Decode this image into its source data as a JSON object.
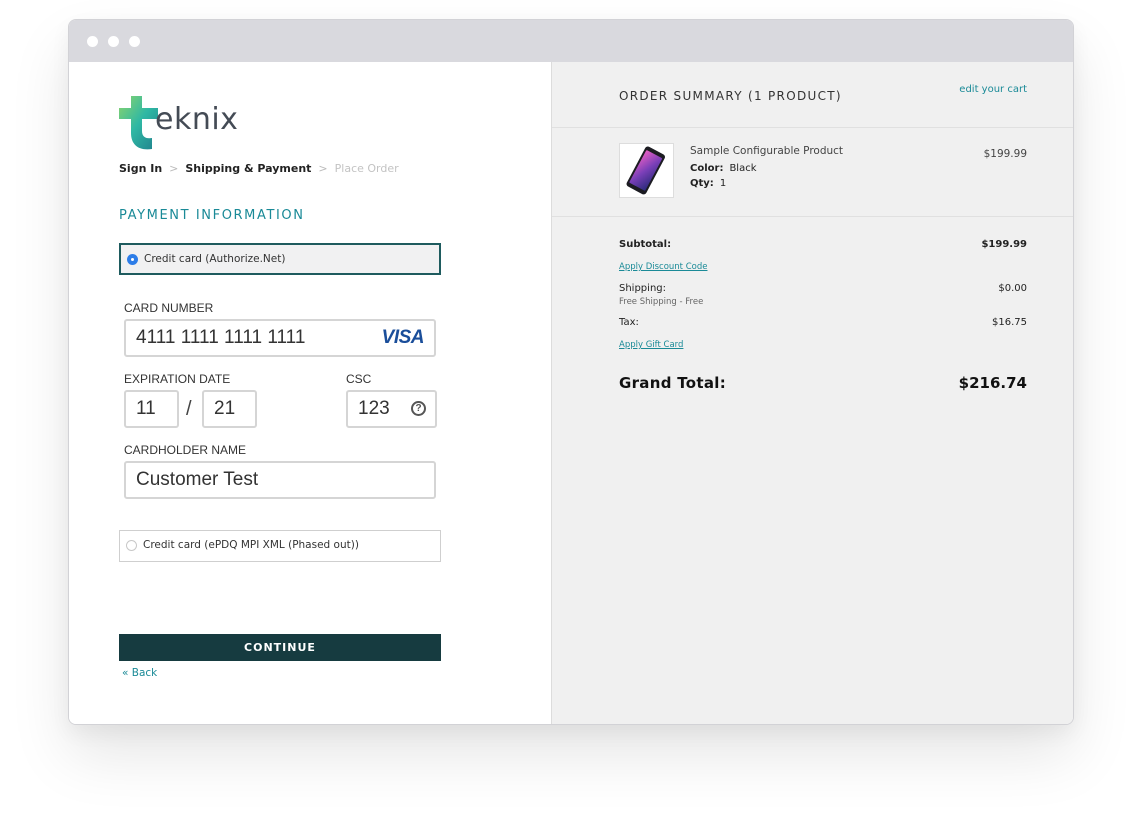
{
  "logo": {
    "text": "eknix"
  },
  "breadcrumb": {
    "step1": "Sign In",
    "step2": "Shipping & Payment",
    "step3": "Place Order"
  },
  "payment": {
    "section_title": "PAYMENT INFORMATION",
    "method1": {
      "label": "Credit card (Authorize.Net)",
      "selected": true
    },
    "method2": {
      "label": "Credit card (ePDQ MPI XML (Phased out))",
      "selected": false
    },
    "card_number_label": "CARD NUMBER",
    "card_number": "4111 1111 1111 1111",
    "card_brand": "VISA",
    "expiration_label": "EXPIRATION DATE",
    "exp_month": "11",
    "exp_separator": "/",
    "exp_year": "21",
    "csc_label": "CSC",
    "csc": "123",
    "cardholder_label": "CARDHOLDER NAME",
    "cardholder": "Customer Test",
    "continue_label": "CONTINUE",
    "back_label": "« Back"
  },
  "summary": {
    "title": "ORDER SUMMARY (1 PRODUCT)",
    "edit_cart": "edit your cart",
    "product": {
      "name": "Sample Configurable Product",
      "price": "$199.99",
      "color_label": "Color:",
      "color": "Black",
      "qty_label": "Qty:",
      "qty": "1"
    },
    "subtotal_label": "Subtotal:",
    "subtotal": "$199.99",
    "discount_link": "Apply Discount Code",
    "shipping_label": "Shipping:",
    "shipping_method": "Free Shipping - Free",
    "shipping": "$0.00",
    "tax_label": "Tax:",
    "tax": "$16.75",
    "gift_card_link": "Apply Gift Card",
    "grand_total_label": "Grand Total:",
    "grand_total": "$216.74"
  },
  "colors": {
    "accent": "#1a8a97",
    "button": "#163b40",
    "radio_selected": "#2d7de8",
    "selected_border": "#1e5b5e",
    "visa": "#1a4e9a"
  }
}
